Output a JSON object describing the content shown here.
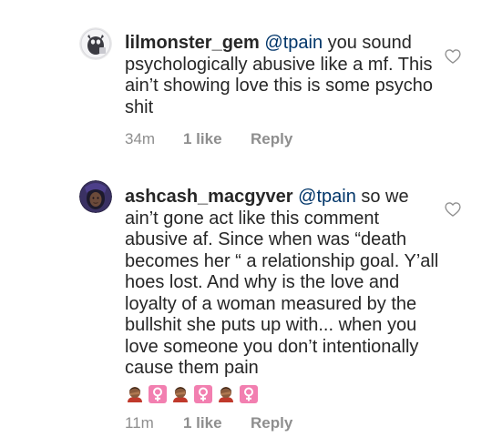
{
  "comments": [
    {
      "username": "lilmonster_gem",
      "mention": "@tpain",
      "text": " you sound psychologically abusive like a mf. This ain’t showing love this is some psycho shit",
      "time": "34m",
      "likes": "1 like",
      "reply_label": "Reply",
      "avatar_icon": "profile-photo-avatar",
      "like_icon": "heart-outline-icon"
    },
    {
      "username": "ashcash_macgyver",
      "mention": "@tpain",
      "text": " so we ain’t gone act like this comment abusive af. Since when was “death becomes her “ a relationship goal. Y’all hoes lost. And why is the love and loyalty of a woman measured by the bullshit she puts up with... when you love someone you don’t intentionally cause them pain",
      "emojis": [
        "woman-facepalming-emoji",
        "female-sign-emoji",
        "woman-facepalming-emoji",
        "female-sign-emoji",
        "woman-facepalming-emoji",
        "female-sign-emoji"
      ],
      "time": "11m",
      "likes": "1 like",
      "reply_label": "Reply",
      "avatar_icon": "profile-photo-avatar",
      "like_icon": "heart-outline-icon"
    }
  ],
  "colors": {
    "text": "#262626",
    "mention": "#003569",
    "meta": "#8e8e8e",
    "female_sign_bg": "#f27fb0"
  }
}
